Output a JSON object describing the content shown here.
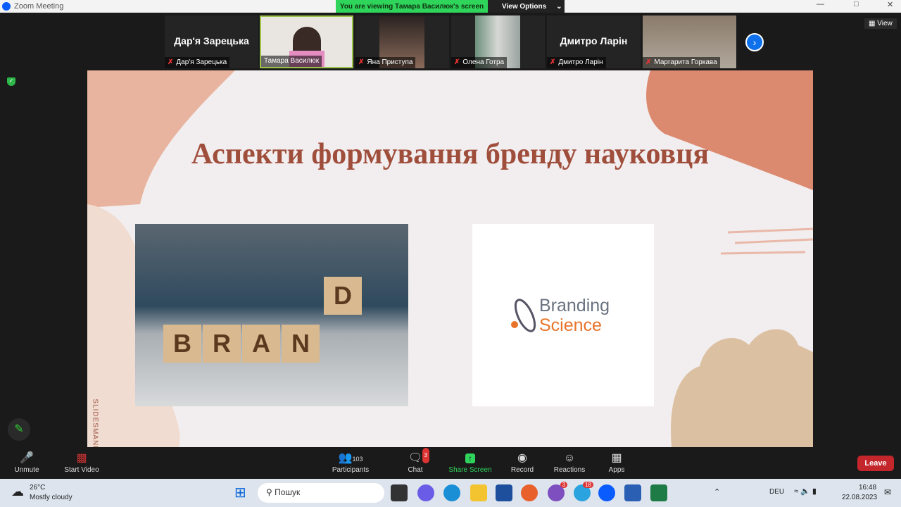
{
  "window": {
    "title": "Zoom Meeting",
    "banner": "You are viewing Тамара Василюк's screen",
    "view_options": "View Options",
    "view": "View"
  },
  "participants_strip": [
    {
      "display": "Дар'я Зарецька",
      "name": "Дар'я Зарецька",
      "muted": true
    },
    {
      "name": "Тамара Василюк",
      "muted": false,
      "video": true
    },
    {
      "name": "Яна Приступа",
      "muted": true,
      "video": true
    },
    {
      "name": "Олена Готра",
      "muted": true,
      "video": true
    },
    {
      "display": "Дмитро Ларін",
      "name": "Дмитро Ларін",
      "muted": true
    },
    {
      "name": "Маргарита Горкава",
      "muted": true,
      "video": true
    }
  ],
  "slide": {
    "title": "Аспекти формування бренду науковця",
    "cubes": [
      "B",
      "R",
      "A",
      "N",
      "D"
    ],
    "logo_line1": "Branding",
    "logo_line2": "Science",
    "side_text": "SLIDESMANIA"
  },
  "toolbar": {
    "unmute": "Unmute",
    "start_video": "Start Video",
    "participants": "Participants",
    "participants_count": "103",
    "chat": "Chat",
    "chat_badge": "3",
    "share": "Share Screen",
    "record": "Record",
    "reactions": "Reactions",
    "apps": "Apps",
    "leave": "Leave"
  },
  "taskbar": {
    "temp": "26°C",
    "weather": "Mostly cloudy",
    "search": "Пошук",
    "viber_badge": "3",
    "telegram_badge": "18",
    "lang": "DEU",
    "time": "16:48",
    "date": "22.08.2023"
  },
  "colors": {
    "accent": "#0e71eb",
    "share": "#2fd45b",
    "leave": "#c4272b",
    "slide_title": "#a04e3c"
  }
}
